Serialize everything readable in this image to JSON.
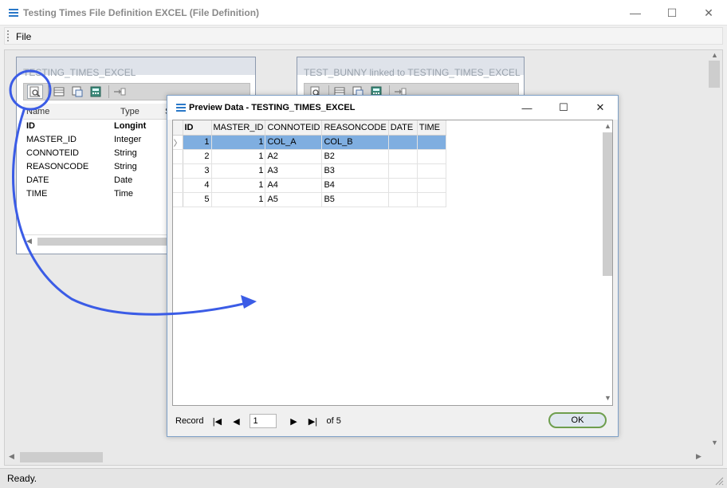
{
  "window": {
    "title": "Testing Times File Definition EXCEL (File Definition)",
    "controls": {
      "minimize": "—",
      "maximize": "☐",
      "close": "✕"
    }
  },
  "menu": {
    "file": "File"
  },
  "panels": {
    "left": {
      "title": "TESTING_TIMES_EXCEL",
      "columns": [
        "Name",
        "Type",
        "S"
      ],
      "fields": [
        {
          "name": "ID",
          "type": "Longint",
          "key": true
        },
        {
          "name": "MASTER_ID",
          "type": "Integer"
        },
        {
          "name": "CONNOTEID",
          "type": "String"
        },
        {
          "name": "REASONCODE",
          "type": "String"
        },
        {
          "name": "DATE",
          "type": "Date"
        },
        {
          "name": "TIME",
          "type": "Time"
        }
      ]
    },
    "right": {
      "title": "TEST_BUNNY linked to TESTING_TIMES_EXCEL"
    }
  },
  "preview": {
    "title": "Preview Data - TESTING_TIMES_EXCEL",
    "columns": [
      "ID",
      "MASTER_ID",
      "CONNOTEID",
      "REASONCODE",
      "DATE",
      "TIME"
    ],
    "rows": [
      [
        "1",
        "1",
        "COL_A",
        "COL_B",
        "",
        ""
      ],
      [
        "2",
        "1",
        "A2",
        "B2",
        "",
        ""
      ],
      [
        "3",
        "1",
        "A3",
        "B3",
        "",
        ""
      ],
      [
        "4",
        "1",
        "A4",
        "B4",
        "",
        ""
      ],
      [
        "5",
        "1",
        "A5",
        "B5",
        "",
        ""
      ]
    ],
    "selected_row_index": 0,
    "nav": {
      "record_label": "Record",
      "current": "1",
      "of_label": "of 5"
    },
    "ok_label": "OK"
  },
  "status": {
    "text": "Ready."
  },
  "colors": {
    "accent": "#2a78c8",
    "selection": "#7faee0",
    "annotation": "#3b5ce6",
    "ok_border": "#6e9e4e"
  }
}
